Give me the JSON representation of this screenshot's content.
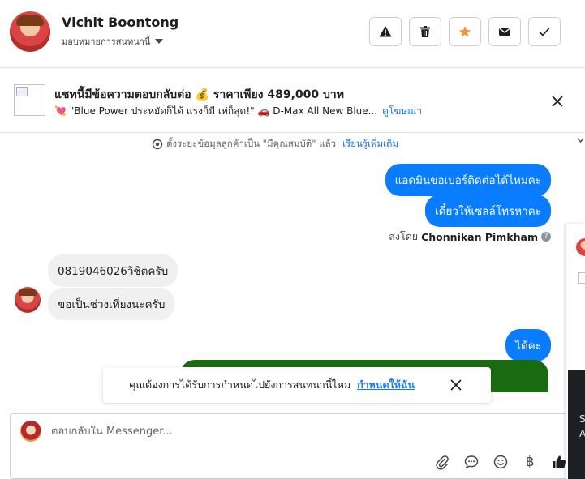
{
  "header": {
    "contact_name": "Vichit Boontong",
    "assign_label": "มอบหมายการสนทนานี้",
    "actions": [
      {
        "name": "report-button",
        "icon": "warning-icon"
      },
      {
        "name": "delete-button",
        "icon": "trash-icon"
      },
      {
        "name": "star-button",
        "icon": "star-icon",
        "color": "#f7923a"
      },
      {
        "name": "mark-unread-button",
        "icon": "envelope-icon"
      },
      {
        "name": "mark-done-button",
        "icon": "check-icon"
      }
    ]
  },
  "ad": {
    "title": "แชทนี้มีข้อความตอบกลับต่อ 💰 ราคาเพียง 489,000 บาท",
    "subtitle": "💘 \"Blue Power ประหยัดก็ได้ แรงก็มี เท่ก็สุด!\" 🚗 D-Max All New Blue...",
    "link": "ดูโฆษณา"
  },
  "system_note": {
    "text": "ตั้งระยะข้อมูลลูกค้าเป็น \"มีคุณสมบัติ\" แล้ว",
    "link": "เรียนรู้เพิ่มเติม"
  },
  "messages": {
    "out_1": "แอดมินขอเบอร์ติดต่อได้ไหมคะ",
    "out_2": "เดี๋ยวให้เซลล์โทรหาคะ",
    "sent_by_prefix": "ส่งโดย",
    "sent_by_name": "Chonnikan Pimkham",
    "in_1": "0819046026วิชิตครับ",
    "in_2": "ขอเป็นช่วงเที่ยงนะครับ",
    "out_3": "ได้คะ"
  },
  "toast": {
    "text": "คุณต้องการได้รับการกำหนดไปยังการสนทนานี้ไหม",
    "link": "กำหนดให้ฉัน"
  },
  "composer": {
    "placeholder": "ตอบกลับใน Messenger...",
    "baht_symbol": "฿",
    "tools": [
      "attachment-icon",
      "saved-reply-icon",
      "emoji-icon",
      "baht-icon",
      "like-icon"
    ]
  },
  "edge_panel": {
    "letters": [
      "S",
      "A"
    ]
  },
  "colors": {
    "accent": "#1877f2",
    "outgoing_bubble": "#0a7cff",
    "incoming_bubble": "#f0f0f0",
    "star": "#f7923a",
    "green_card": "#1a6b0f"
  }
}
